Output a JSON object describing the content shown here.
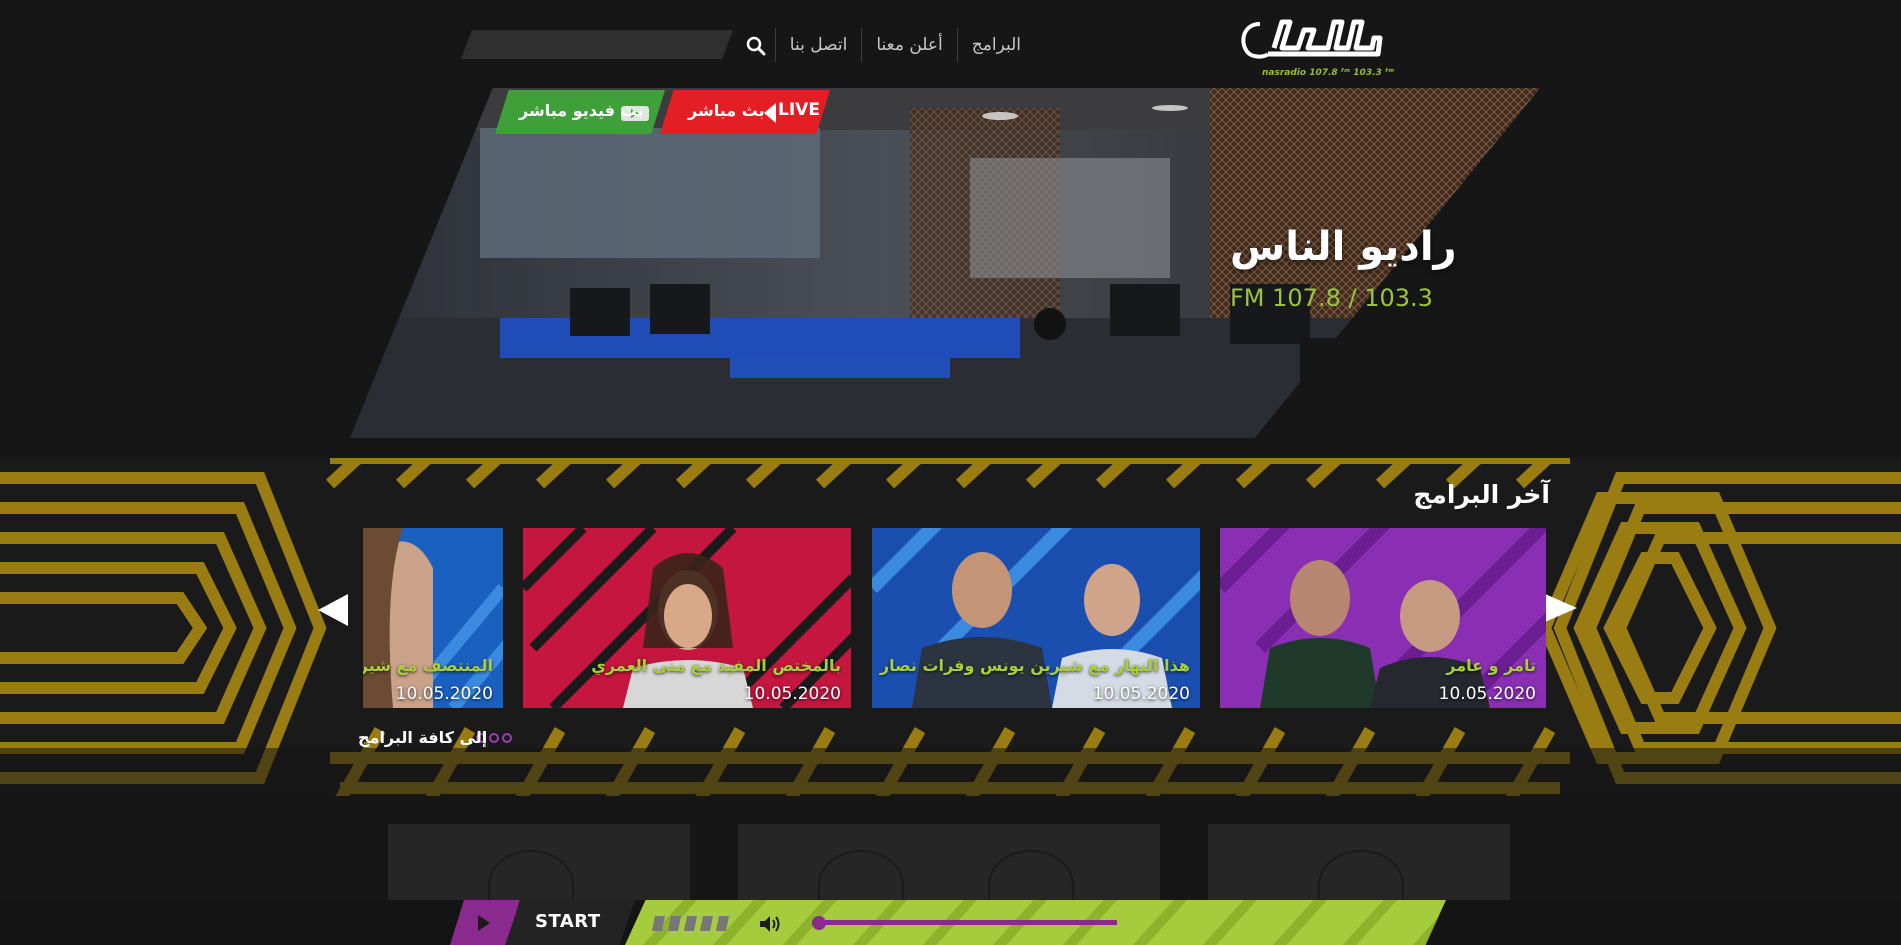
{
  "header": {
    "logo_text": "الناس",
    "logo_caption": "nasradio 107.8 ᶠᵐ 103.3 ᶠᵐ",
    "nav": [
      "البرامج",
      "أعلن معنا",
      "اتصل بنا"
    ],
    "search": {
      "placeholder": "",
      "value": ""
    }
  },
  "hero": {
    "live_label": "LIVE",
    "live_text": "بث مباشر",
    "video_text": "بث فيديو مباشر",
    "title": "راديو الناس",
    "subtitle": "FM 107.8 / 103.3",
    "accent": "#9bc43b",
    "live_color": "#e31e24",
    "video_color": "#3fa03a"
  },
  "programs": {
    "title": "آخر البرامج",
    "all_link": "إلى كافة البرامج",
    "cards": [
      {
        "title": "تامر و عامر",
        "date": "10.05.2020",
        "bg": "#8a2fb3"
      },
      {
        "title": "هذا النهار مع شيرين يونس وفرات نصار",
        "date": "10.05.2020",
        "bg": "#1a4fb0"
      },
      {
        "title": "بالمختص المفيد مع منى العمري",
        "date": "10.05.2020",
        "bg": "#c4163f"
      },
      {
        "title": "المنتصف مع شيرين",
        "date": "10.05.2020",
        "bg": "#1a60c0"
      }
    ]
  },
  "player": {
    "start_label": "START",
    "play_color": "#8a2a8f",
    "bar_color": "#a5cc3c"
  }
}
